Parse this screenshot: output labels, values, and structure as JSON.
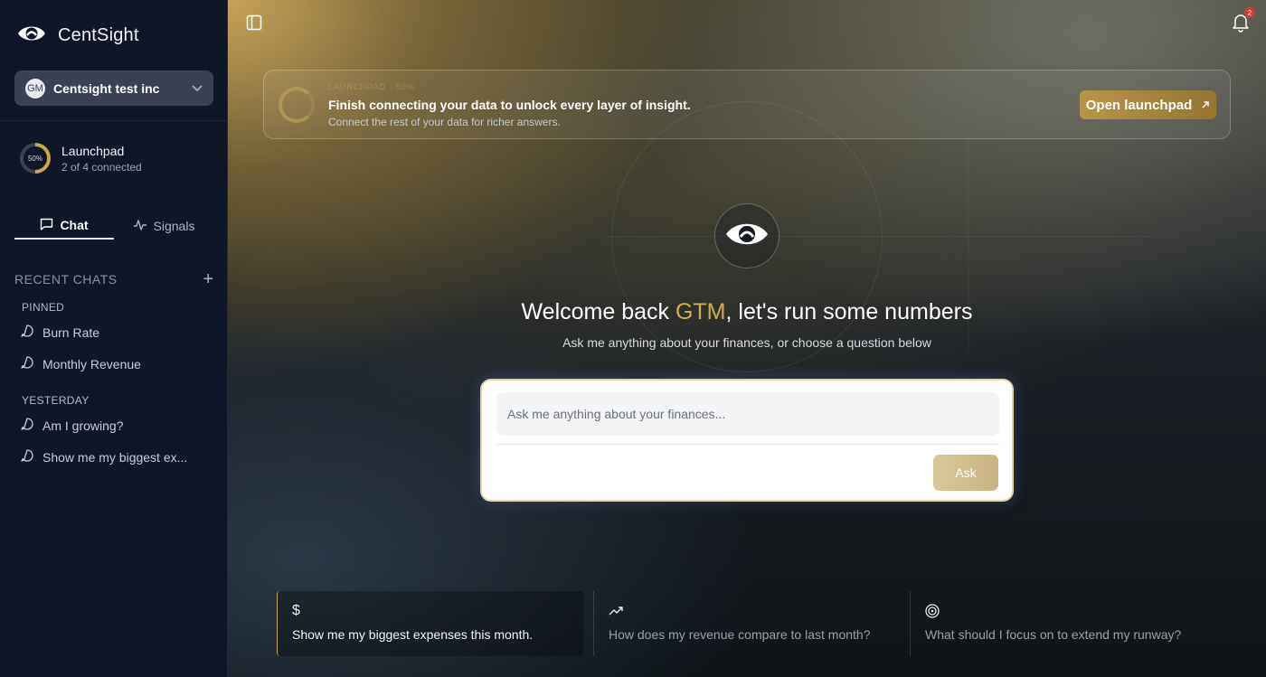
{
  "brand": {
    "name": "CentSight"
  },
  "org": {
    "initials": "GM",
    "name": "Centsight test inc"
  },
  "launchpad": {
    "percent_label": "50%",
    "progress": 0.5,
    "title": "Launchpad",
    "subtitle": "2 of 4 connected"
  },
  "tabs": [
    {
      "label": "Chat",
      "icon": "chat-icon",
      "active": true
    },
    {
      "label": "Signals",
      "icon": "activity-icon",
      "active": false
    }
  ],
  "recent": {
    "label": "RECENT CHATS"
  },
  "groups": {
    "pinned": {
      "label": "PINNED",
      "items": [
        "Burn Rate",
        "Monthly Revenue"
      ]
    },
    "yesterday": {
      "label": "YESTERDAY",
      "items": [
        "Am I growing?",
        "Show me my biggest ex..."
      ]
    }
  },
  "notifications": {
    "count": "2"
  },
  "banner": {
    "kicker": "LAUNCHPAD · 50%",
    "title": "Finish connecting your data to unlock every layer of insight.",
    "subtitle": "Connect the rest of your data for richer answers.",
    "button": "Open launchpad"
  },
  "hero": {
    "welcome_prefix": "Welcome back ",
    "user": "GTM",
    "welcome_suffix": ", let's run some numbers",
    "subtitle": "Ask me anything about your finances, or choose a question below"
  },
  "ask": {
    "placeholder": "Ask me anything about your finances...",
    "value": "",
    "button": "Ask"
  },
  "suggestions": [
    {
      "icon": "dollar-icon",
      "glyph": "$",
      "text": "Show me my biggest expenses this month."
    },
    {
      "icon": "trending-up-icon",
      "glyph": "",
      "text": "How does my revenue compare to last month?"
    },
    {
      "icon": "target-icon",
      "glyph": "",
      "text": "What should I focus on to extend my runway?"
    }
  ],
  "colors": {
    "accent": "#c9a54a",
    "sidebar": "#0f1628",
    "notification": "#d23a3a"
  }
}
